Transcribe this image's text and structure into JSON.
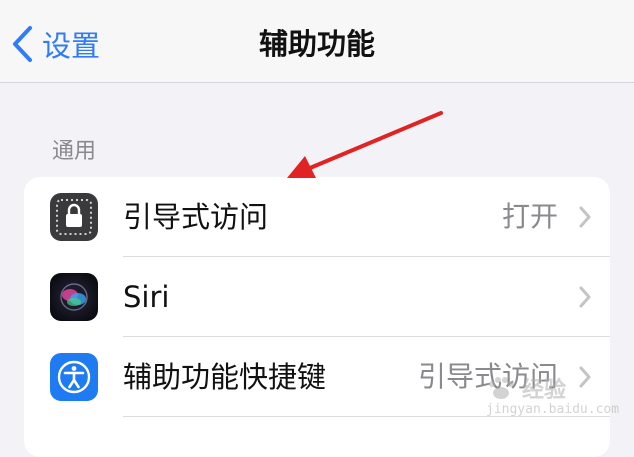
{
  "nav": {
    "back_label": "设置",
    "title": "辅助功能"
  },
  "section": {
    "header": "通用"
  },
  "rows": [
    {
      "label": "引导式访问",
      "value": "打开",
      "icon": "lock-icon"
    },
    {
      "label": "Siri",
      "value": "",
      "icon": "siri-icon"
    },
    {
      "label": "辅助功能快捷键",
      "value": "引导式访问",
      "icon": "accessibility-icon"
    }
  ],
  "colors": {
    "accent": "#2f7cf6",
    "annotation_arrow": "#e02424",
    "background": "#f2f2f7"
  },
  "watermark": {
    "text": "经验",
    "url": "jingyan.baidu.com"
  }
}
